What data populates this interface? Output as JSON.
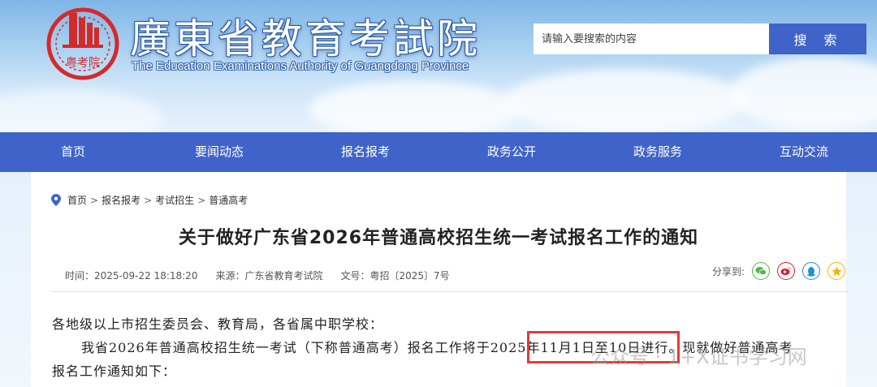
{
  "header": {
    "title_cn": "廣東省教育考試院",
    "title_en": "The Education Examinations Authority of Guangdong Province",
    "seal_text": "粤考院",
    "search_placeholder": "请输入要搜索的内容",
    "search_button": "搜 索"
  },
  "nav": {
    "items": [
      {
        "label": "首页"
      },
      {
        "label": "要闻动态"
      },
      {
        "label": "报名报考"
      },
      {
        "label": "政务公开"
      },
      {
        "label": "政务服务"
      },
      {
        "label": "互动交流"
      }
    ]
  },
  "breadcrumb": {
    "items": [
      "首页",
      "报名报考",
      "考试招生",
      "普通高考"
    ],
    "separator": ">"
  },
  "article": {
    "title": "关于做好广东省2026年普通高校招生统一考试报名工作的通知",
    "time": "时间：2025-09-22 18:18:20",
    "source": "来源：广东省教育考试院",
    "doc_no": "文号：粤招〔2025〕7号",
    "share_label": "分享到:",
    "share_icons": [
      "wechat-icon",
      "weibo-icon",
      "qq-icon",
      "qzone-icon"
    ],
    "para1": "各地级以上市招生委员会、教育局，各省属中职学校：",
    "para2": "我省2026年普通高校招生统一考试（下称普通高考）报名工作将于2025年11月1日至10日进行。现就做好普通高考",
    "para3": "报名工作通知如下："
  },
  "watermark": "公众号 · 1+X证书学习网",
  "colors": {
    "nav_bg": "#3f63c9",
    "search_btn": "#3f63c8",
    "seal_red": "#d42a2a",
    "highlight_border": "#e23a3a"
  }
}
